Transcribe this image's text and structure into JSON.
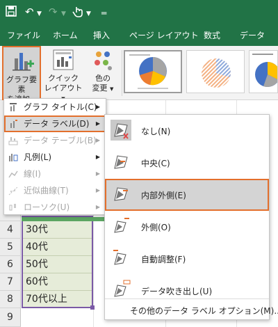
{
  "tabs": [
    "ファイル",
    "ホーム",
    "挿入",
    "ページ レイアウト",
    "数式",
    "データ"
  ],
  "ribbon": {
    "add_element": [
      "グラフ要素",
      "を追加"
    ],
    "quick_layout": [
      "クイック",
      "レイアウト"
    ],
    "change_color": [
      "色の",
      "変更"
    ]
  },
  "menu_add_element": [
    {
      "label": "グラフ タイトル(C)",
      "enabled": true,
      "highlighted": false
    },
    {
      "label": "データ ラベル(D)",
      "enabled": true,
      "highlighted": true
    },
    {
      "label": "データ テーブル(B)",
      "enabled": false,
      "highlighted": false
    },
    {
      "label": "凡例(L)",
      "enabled": true,
      "highlighted": false
    },
    {
      "label": "線(I)",
      "enabled": false,
      "highlighted": false
    },
    {
      "label": "近似曲線(T)",
      "enabled": false,
      "highlighted": false
    },
    {
      "label": "ローソク(U)",
      "enabled": false,
      "highlighted": false
    }
  ],
  "menu_data_labels": [
    {
      "label": "なし(N)",
      "highlighted": false
    },
    {
      "label": "中央(C)",
      "highlighted": false
    },
    {
      "label": "内部外側(E)",
      "highlighted": true
    },
    {
      "label": "外側(O)",
      "highlighted": false
    },
    {
      "label": "自動調整(F)",
      "highlighted": false
    },
    {
      "label": "データ吹き出し(U)",
      "highlighted": false
    }
  ],
  "more_options": "その他のデータ ラベル オプション(M)...",
  "sheet": {
    "rows": [
      {
        "num": "4",
        "value": "30代"
      },
      {
        "num": "5",
        "value": "40代"
      },
      {
        "num": "6",
        "value": "50代"
      },
      {
        "num": "7",
        "value": "60代"
      },
      {
        "num": "8",
        "value": "70代以上"
      },
      {
        "num": "9",
        "value": ""
      }
    ]
  },
  "colors": {
    "excel_green": "#217346",
    "highlight_border": "#e36f2c",
    "cell_fill": "#e6ecd9"
  }
}
